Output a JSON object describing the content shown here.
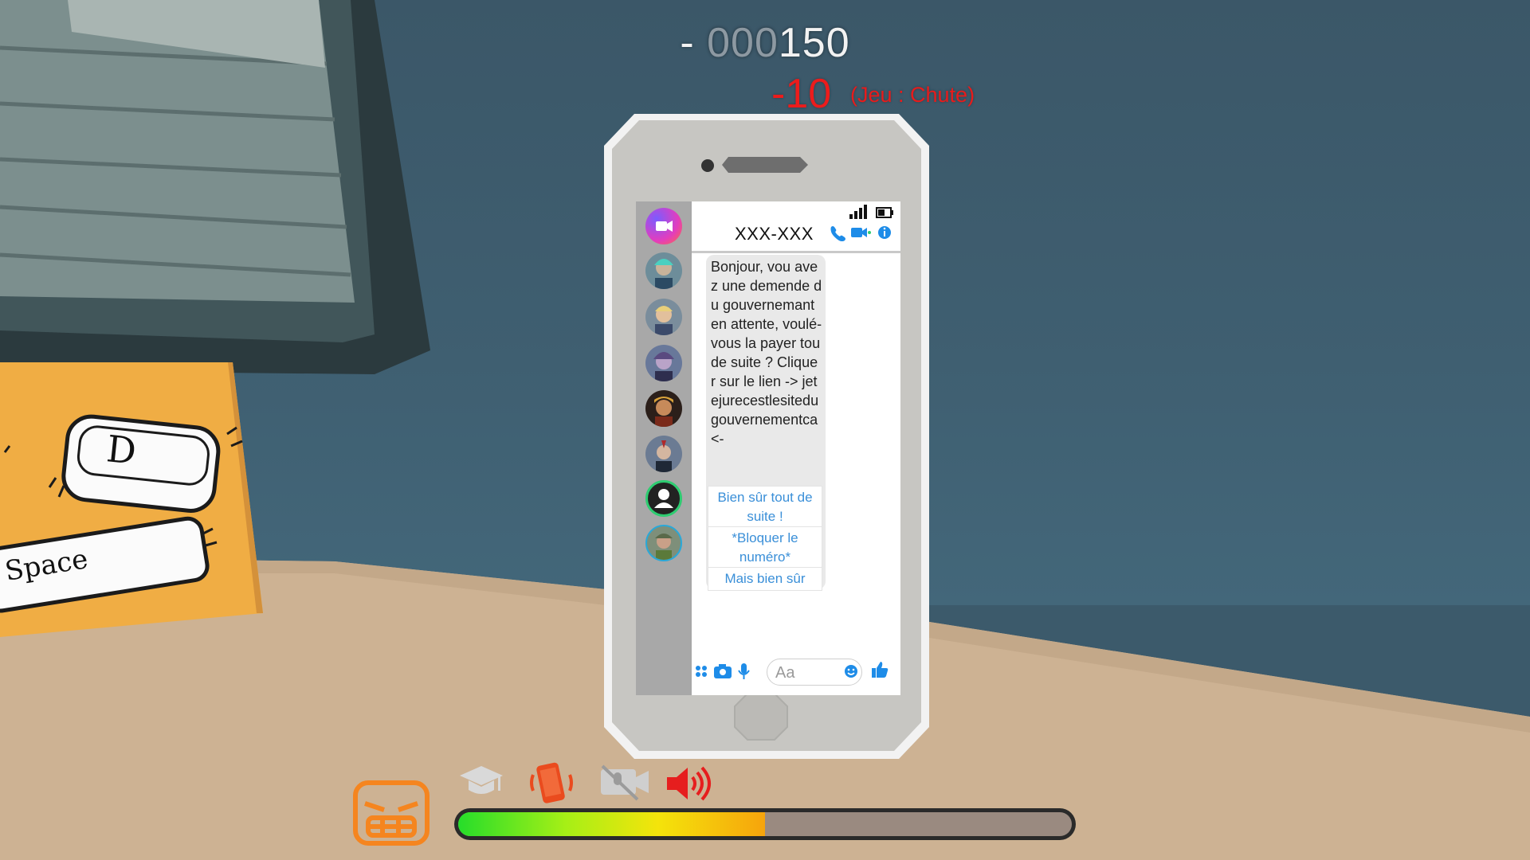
{
  "hud": {
    "score_prefix": "-",
    "score_lead": "000",
    "score_main": "150",
    "penalty": "-10",
    "penalty_reason": "(Jeu : Chute)"
  },
  "keys": {
    "key_d": "D",
    "key_space": "Space"
  },
  "phone": {
    "contact_name": "XXX-XXX",
    "message": "Bonjour, vou avez une demende du gouvernemant en attente, voulé-vous la payer tou de suite ? Cliquer sur le lien -> jetejurecestlesitedugouvernementca <-",
    "replies": [
      "Bien sûr tout de suite !",
      "*Bloquer le numéro*",
      "Mais bien sûr"
    ],
    "composer_placeholder": "Aa"
  },
  "status_icons": [
    "angry-face-icon",
    "graduation-cap-icon",
    "phone-vibrate-icon",
    "muted-camera-icon",
    "speaker-loud-icon"
  ],
  "meter": {
    "level": 0.5
  },
  "colors": {
    "accent_orange": "#f5851f",
    "penalty_red": "#e81b1b",
    "link_blue": "#3a8fd8"
  }
}
